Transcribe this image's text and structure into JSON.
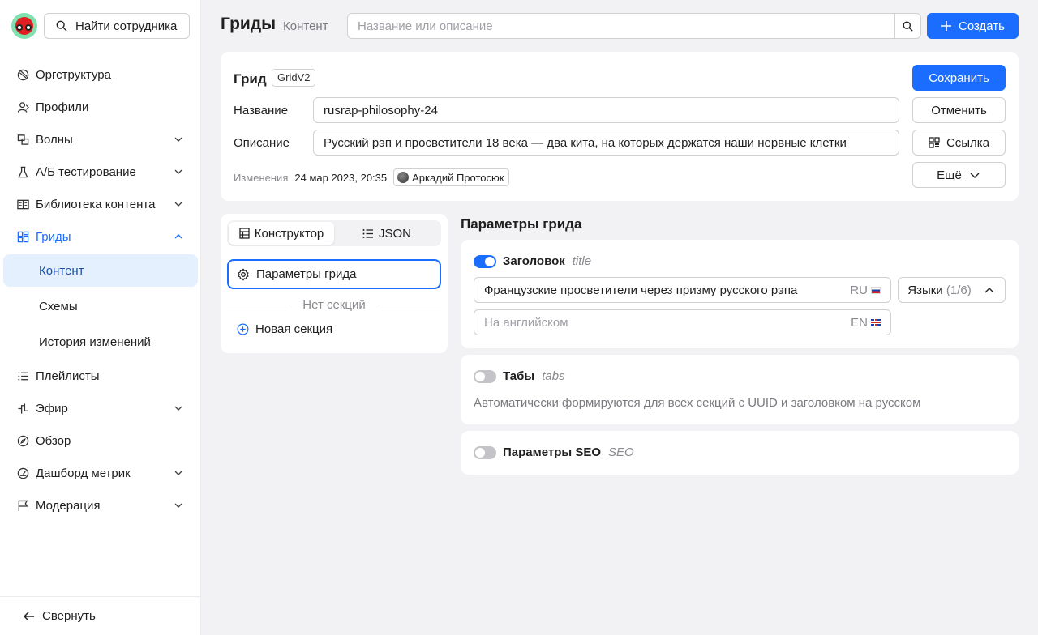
{
  "sidebar": {
    "search_label": "Найти сотрудника",
    "items": [
      {
        "label": "Оргструктура",
        "icon": "org-icon"
      },
      {
        "label": "Профили",
        "icon": "profile-icon"
      },
      {
        "label": "Волны",
        "icon": "waves-icon"
      },
      {
        "label": "А/Б тестирование",
        "icon": "flask-icon"
      },
      {
        "label": "Библиотека контента",
        "icon": "book-icon"
      },
      {
        "label": "Гриды",
        "icon": "grid-icon"
      },
      {
        "label": "Плейлисты",
        "icon": "list-icon"
      },
      {
        "label": "Эфир",
        "icon": "broadcast-icon"
      },
      {
        "label": "Обзор",
        "icon": "compass-icon"
      },
      {
        "label": "Дашборд метрик",
        "icon": "gauge-icon"
      },
      {
        "label": "Модерация",
        "icon": "flag-icon"
      }
    ],
    "sub_items": [
      "Контент",
      "Схемы",
      "История изменений"
    ],
    "collapse_label": "Свернуть"
  },
  "header": {
    "title": "Гриды",
    "subtitle": "Контент",
    "search_placeholder": "Название или описание",
    "create_label": "Создать"
  },
  "grid": {
    "title": "Грид",
    "badge": "GridV2",
    "name_label": "Название",
    "name_value": "rusrap-philosophy-24",
    "desc_label": "Описание",
    "desc_value": "Русский рэп и просветители 18 века — два кита, на которых держатся наши нервные клетки",
    "changes_label": "Изменения",
    "changes_date": "24 мар 2023, 20:35",
    "author": "Аркадий Протосюк",
    "save_label": "Сохранить",
    "cancel_label": "Отменить",
    "link_label": "Ссылка",
    "more_label": "Ещё"
  },
  "constructor": {
    "tab_constructor": "Конструктор",
    "tab_json": "JSON",
    "params_button": "Параметры грида",
    "no_sections": "Нет секций",
    "new_section": "Новая секция"
  },
  "params": {
    "title": "Параметры грида",
    "heading": {
      "label": "Заголовок",
      "key": "title",
      "ru_value": "Французские просветители через призму русского рэпа",
      "ru_tag": "RU",
      "en_placeholder": "На английском",
      "en_tag": "EN",
      "languages_label": "Языки",
      "languages_count": "(1/6)"
    },
    "tabs": {
      "label": "Табы",
      "key": "tabs",
      "description": "Автоматически формируются для всех секций с UUID и заголовком на русском"
    },
    "seo": {
      "label": "Параметры SEO",
      "key": "SEO"
    }
  },
  "colors": {
    "accent": "#1a6dff",
    "selected_bg": "#e5f0ff",
    "page_bg": "#f2f2f4"
  }
}
